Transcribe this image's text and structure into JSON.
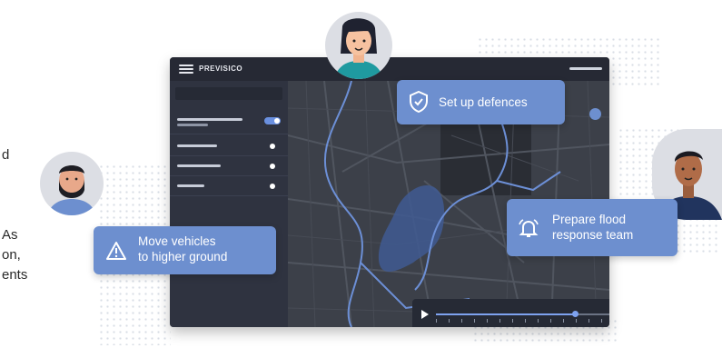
{
  "left_text": {
    "line1": "d",
    "line2": "As",
    "line3": "on,",
    "line4": "ents"
  },
  "app": {
    "logo": "PREVISICO"
  },
  "bubbles": {
    "defences": "Set up defences",
    "flood_line1": "Prepare flood",
    "flood_line2": "response team",
    "vehicles_line1": "Move vehicles",
    "vehicles_line2": "to higher ground"
  },
  "timeline": {
    "progress": 0.52
  },
  "sidebar": {
    "toggle_on": true,
    "rows": 4
  },
  "colors": {
    "accent": "#6d8fcf",
    "panel": "#2b2f38",
    "map": "#3c4049",
    "river": "#6c8fd6"
  },
  "icons": [
    "menu-icon",
    "shield-check-icon",
    "bell-icon",
    "warning-triangle-icon",
    "play-icon"
  ]
}
